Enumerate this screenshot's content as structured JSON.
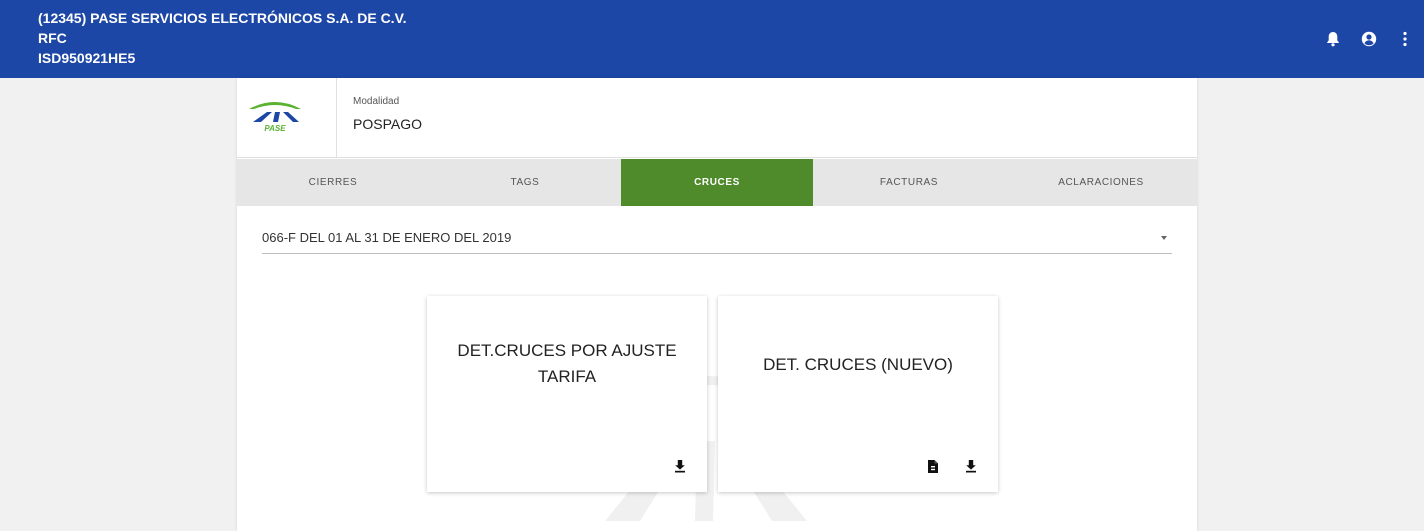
{
  "header": {
    "company": "(12345) PASE SERVICIOS ELECTRÓNICOS S.A. DE C.V.",
    "rfc_label": "RFC",
    "rfc_value": "ISD950921HE5",
    "icons": [
      "bell-icon",
      "account-icon",
      "more-vert-icon"
    ]
  },
  "account": {
    "logo_text": "PASE",
    "modalidad_label": "Modalidad",
    "modalidad_value": "POSPAGO"
  },
  "tabs": [
    {
      "label": "CIERRES",
      "active": false
    },
    {
      "label": "TAGS",
      "active": false
    },
    {
      "label": "CRUCES",
      "active": true
    },
    {
      "label": "FACTURAS",
      "active": false
    },
    {
      "label": "ACLARACIONES",
      "active": false
    }
  ],
  "period": {
    "selected": "066-F DEL 01 AL 31 DE ENERO DEL 2019"
  },
  "cards": [
    {
      "title_line1": "DET.CRUCES POR AJUSTE",
      "title_line2": "TARIFA",
      "icons": [
        "download-icon"
      ]
    },
    {
      "title_line1": "DET. CRUCES (NUEVO)",
      "icons": [
        "pdf-file-icon",
        "download-icon"
      ]
    }
  ],
  "colors": {
    "header_bg": "#1d47a6",
    "active_tab": "#4f8a2b",
    "logo_green": "#5bb231",
    "logo_blue": "#1d47a6"
  }
}
